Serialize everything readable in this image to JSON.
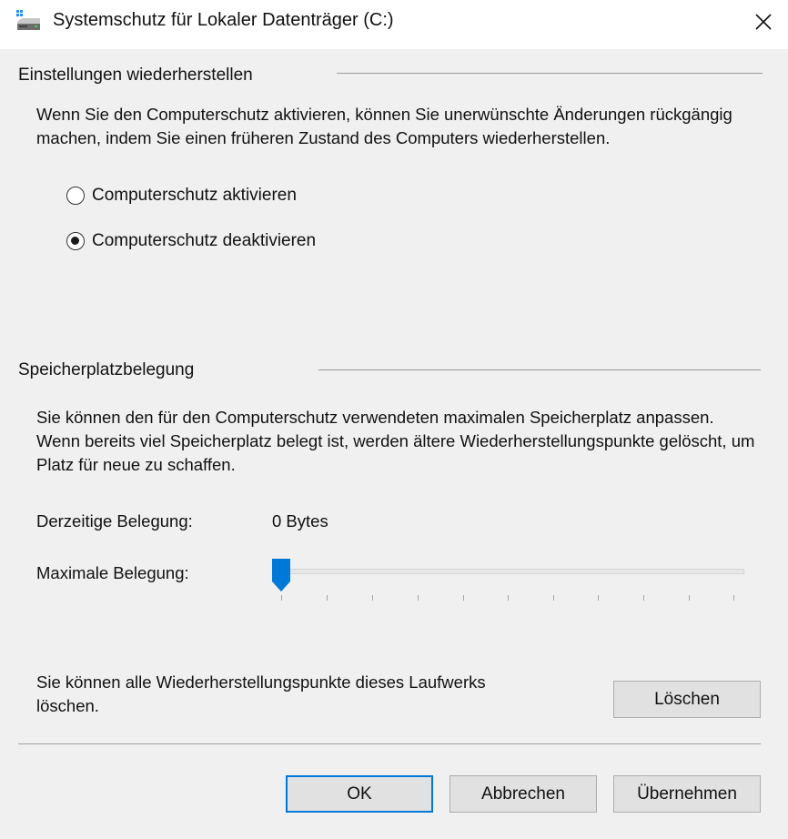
{
  "window": {
    "title": "Systemschutz für Lokaler Datenträger (C:)",
    "icon": "drive-icon",
    "close_icon": "close-icon"
  },
  "restore_settings": {
    "title": "Einstellungen wiederherstellen",
    "description": "Wenn Sie den Computerschutz aktivieren, können Sie unerwünschte Änderungen rückgängig machen, indem Sie einen früheren Zustand des Computers wiederherstellen.",
    "options": [
      {
        "label": "Computerschutz aktivieren",
        "checked": false
      },
      {
        "label": "Computerschutz deaktivieren",
        "checked": true
      }
    ]
  },
  "disk_usage": {
    "title": "Speicherplatzbelegung",
    "description": "Sie können den für den Computerschutz verwendeten maximalen Speicherplatz anpassen. Wenn bereits viel Speicherplatz belegt ist, werden ältere Wiederherstellungspunkte gelöscht, um Platz für neue zu schaffen.",
    "current_label": "Derzeitige Belegung:",
    "current_value": "0 Bytes",
    "max_label": "Maximale Belegung:",
    "max_slider_fraction": 0,
    "delete_text": "Sie können alle Wiederherstellungspunkte dieses Laufwerks löschen.",
    "delete_button": "Löschen"
  },
  "footer": {
    "ok": "OK",
    "cancel": "Abbrechen",
    "apply": "Übernehmen"
  },
  "colors": {
    "accent": "#0078d7",
    "background": "#f0f0f0"
  }
}
